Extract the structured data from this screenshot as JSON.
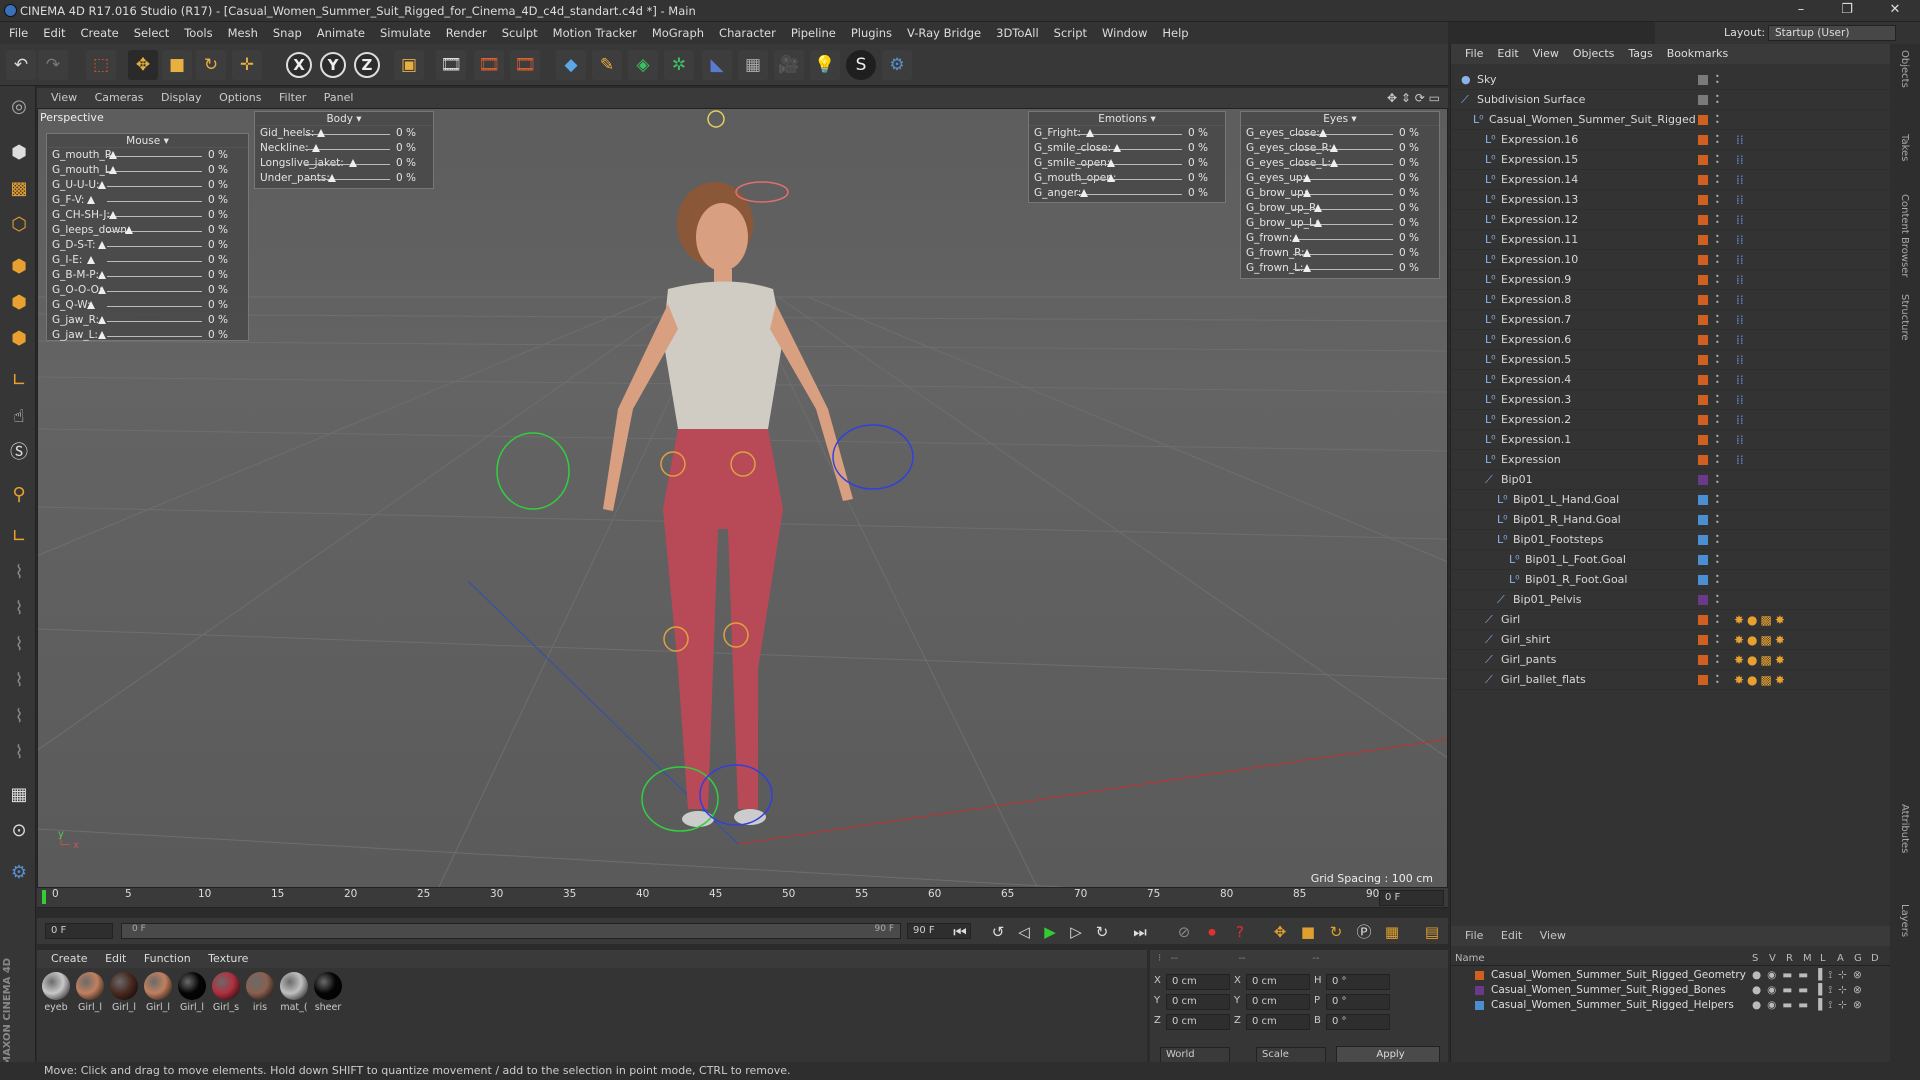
{
  "window": {
    "title": "CINEMA 4D R17.016 Studio (R17) - [Casual_Women_Summer_Suit_Rigged_for_Cinema_4D_c4d_standart.c4d *] - Main",
    "minimize": "–",
    "restore": "❐",
    "close": "✕"
  },
  "menubar": [
    "File",
    "Edit",
    "Create",
    "Select",
    "Tools",
    "Mesh",
    "Snap",
    "Animate",
    "Simulate",
    "Render",
    "Sculpt",
    "Motion Tracker",
    "MoGraph",
    "Character",
    "Pipeline",
    "Plugins",
    "V-Ray Bridge",
    "3DToAll",
    "Script",
    "Window",
    "Help"
  ],
  "layout": {
    "label": "Layout:",
    "value": "Startup (User)"
  },
  "toolbar_axes": [
    "X",
    "Y",
    "Z"
  ],
  "viewport": {
    "menu": [
      "View",
      "Cameras",
      "Display",
      "Options",
      "Filter",
      "Panel"
    ],
    "name": "Perspective",
    "grid_spacing": "Grid Spacing : 100 cm",
    "hud_mouse": {
      "title": "Mouse",
      "rows": [
        "G_mouth_R:",
        "G_mouth_L:",
        "G_U-U-U:",
        "G_F-V:",
        "G_CH-SH-J:",
        "G_leeps_down:",
        "G_D-S-T:",
        "G_I-E:",
        "G_B-M-P:",
        "G_O-O-O:",
        "G_Q-W:",
        "G_jaw_R:",
        "G_jaw_L:"
      ]
    },
    "hud_body": {
      "title": "Body",
      "rows": [
        "Gid_heels:",
        "Neckline:",
        "Longslive_jaket:",
        "Under_pants:"
      ]
    },
    "hud_emotions": {
      "title": "Emotions",
      "rows": [
        "G_Fright:",
        "G_smile_close:",
        "G_smile_open:",
        "G_mouth_open:",
        "G_anger:"
      ]
    },
    "hud_eyes": {
      "title": "Eyes",
      "rows": [
        "G_eyes_close:",
        "G_eyes_close_R:",
        "G_eyes_close_L:",
        "G_eyes_up:",
        "G_brow_up:",
        "G_brow_up_R:",
        "G_brow_up_L:",
        "G_frown:",
        "G_frown_R:",
        "G_frown_L:"
      ]
    },
    "pct": "0 %"
  },
  "timeline": {
    "ticks": [
      "0",
      "5",
      "10",
      "15",
      "20",
      "25",
      "30",
      "35",
      "40",
      "45",
      "50",
      "55",
      "60",
      "65",
      "70",
      "75",
      "80",
      "85",
      "90"
    ],
    "end_field": "0 F"
  },
  "transport": {
    "start": "0 F",
    "range_start": "0 F",
    "range_end": "90 F",
    "end": "90 F"
  },
  "material_menu": [
    "Create",
    "Edit",
    "Function",
    "Texture"
  ],
  "materials": [
    {
      "label": "eyeb",
      "color": "#c8c8c8"
    },
    {
      "label": "Girl_l",
      "color": "#c08060"
    },
    {
      "label": "Girl_l",
      "color": "#4a2a20"
    },
    {
      "label": "Girl_l",
      "color": "#c08060"
    },
    {
      "label": "Girl_l",
      "color": "#050505"
    },
    {
      "label": "Girl_s",
      "color": "#b03040"
    },
    {
      "label": "iris",
      "color": "#8a6050"
    },
    {
      "label": "mat_(",
      "color": "#c0c0c0"
    },
    {
      "label": "sheer",
      "color": "#050505"
    }
  ],
  "coords": {
    "rows": [
      {
        "a": "X",
        "av": "0 cm",
        "b": "X",
        "bv": "0 cm",
        "c": "H",
        "cv": "0 °"
      },
      {
        "a": "Y",
        "av": "0 cm",
        "b": "Y",
        "bv": "0 cm",
        "c": "P",
        "cv": "0 °"
      },
      {
        "a": "Z",
        "av": "0 cm",
        "b": "Z",
        "bv": "0 cm",
        "c": "B",
        "cv": "0 °"
      }
    ],
    "world": "World",
    "scale": "Scale",
    "apply": "Apply"
  },
  "objects": {
    "menu": [
      "File",
      "Edit",
      "View",
      "Objects",
      "Tags",
      "Bookmarks"
    ],
    "items": [
      {
        "name": "Sky",
        "indent": 0,
        "color": "#7a7a7a"
      },
      {
        "name": "Subdivision Surface",
        "indent": 0,
        "color": "#7a7a7a"
      },
      {
        "name": "Casual_Women_Summer_Suit_Rigged",
        "indent": 1,
        "color": "#d06020"
      },
      {
        "name": "Expression.16",
        "indent": 2,
        "color": "#d06020"
      },
      {
        "name": "Expression.15",
        "indent": 2,
        "color": "#d06020"
      },
      {
        "name": "Expression.14",
        "indent": 2,
        "color": "#d06020"
      },
      {
        "name": "Expression.13",
        "indent": 2,
        "color": "#d06020"
      },
      {
        "name": "Expression.12",
        "indent": 2,
        "color": "#d06020"
      },
      {
        "name": "Expression.11",
        "indent": 2,
        "color": "#d06020"
      },
      {
        "name": "Expression.10",
        "indent": 2,
        "color": "#d06020"
      },
      {
        "name": "Expression.9",
        "indent": 2,
        "color": "#d06020"
      },
      {
        "name": "Expression.8",
        "indent": 2,
        "color": "#d06020"
      },
      {
        "name": "Expression.7",
        "indent": 2,
        "color": "#d06020"
      },
      {
        "name": "Expression.6",
        "indent": 2,
        "color": "#d06020"
      },
      {
        "name": "Expression.5",
        "indent": 2,
        "color": "#d06020"
      },
      {
        "name": "Expression.4",
        "indent": 2,
        "color": "#d06020"
      },
      {
        "name": "Expression.3",
        "indent": 2,
        "color": "#d06020"
      },
      {
        "name": "Expression.2",
        "indent": 2,
        "color": "#d06020"
      },
      {
        "name": "Expression.1",
        "indent": 2,
        "color": "#d06020"
      },
      {
        "name": "Expression",
        "indent": 2,
        "color": "#d06020"
      },
      {
        "name": "Bip01",
        "indent": 2,
        "color": "#6a3a8a"
      },
      {
        "name": "Bip01_L_Hand.Goal",
        "indent": 3,
        "color": "#4a90d0"
      },
      {
        "name": "Bip01_R_Hand.Goal",
        "indent": 3,
        "color": "#4a90d0"
      },
      {
        "name": "Bip01_Footsteps",
        "indent": 3,
        "color": "#4a90d0"
      },
      {
        "name": "Bip01_L_Foot.Goal",
        "indent": 4,
        "color": "#4a90d0"
      },
      {
        "name": "Bip01_R_Foot.Goal",
        "indent": 4,
        "color": "#4a90d0"
      },
      {
        "name": "Bip01_Pelvis",
        "indent": 3,
        "color": "#6a3a8a"
      },
      {
        "name": "Girl",
        "indent": 2,
        "color": "#d06020"
      },
      {
        "name": "Girl_shirt",
        "indent": 2,
        "color": "#d06020"
      },
      {
        "name": "Girl_pants",
        "indent": 2,
        "color": "#d06020"
      },
      {
        "name": "Girl_ballet_flats",
        "indent": 2,
        "color": "#d06020"
      }
    ]
  },
  "layers": {
    "menu": [
      "File",
      "Edit",
      "View"
    ],
    "header": "Name",
    "cols": [
      "S",
      "V",
      "R",
      "M",
      "L",
      "A",
      "G",
      "D"
    ],
    "items": [
      {
        "name": "Casual_Women_Summer_Suit_Rigged_Geometry",
        "color": "#d06020"
      },
      {
        "name": "Casual_Women_Summer_Suit_Rigged_Bones",
        "color": "#6a3a8a"
      },
      {
        "name": "Casual_Women_Summer_Suit_Rigged_Helpers",
        "color": "#4a90d0"
      }
    ]
  },
  "right_tabs": [
    "Objects",
    "Takes",
    "Content Browser",
    "Structure",
    "Attributes",
    "Layers"
  ],
  "status": "Move: Click and drag to move elements. Hold down SHIFT to quantize movement / add to the selection in point mode, CTRL to remove.",
  "brand": "MAXON CINEMA 4D"
}
